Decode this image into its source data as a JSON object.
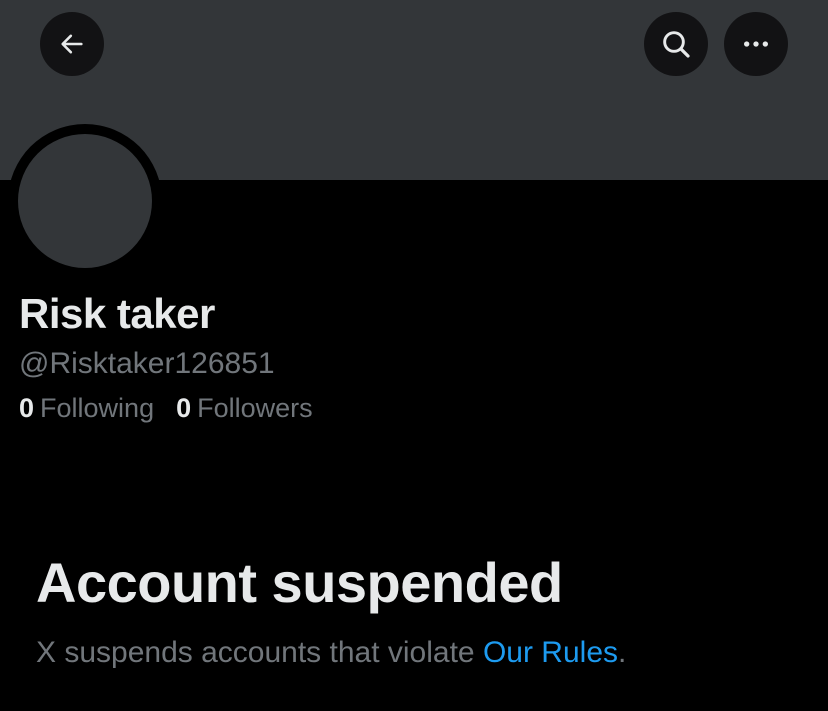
{
  "header": {
    "back_icon": "arrow-left-icon",
    "search_icon": "search-icon",
    "more_icon": "more-horizontal-icon"
  },
  "profile": {
    "display_name": "Risk taker",
    "handle": "@Risktaker126851",
    "following_count": "0",
    "following_label": "Following",
    "followers_count": "0",
    "followers_label": "Followers"
  },
  "notice": {
    "title": "Account suspended",
    "message": "X suspends accounts that violate ",
    "link_text": "Our Rules",
    "trailing": "."
  },
  "colors": {
    "background": "#000000",
    "banner": "#333639",
    "primary_text": "#e7e9ea",
    "secondary_text": "#71767b",
    "link": "#1d9bf0"
  }
}
